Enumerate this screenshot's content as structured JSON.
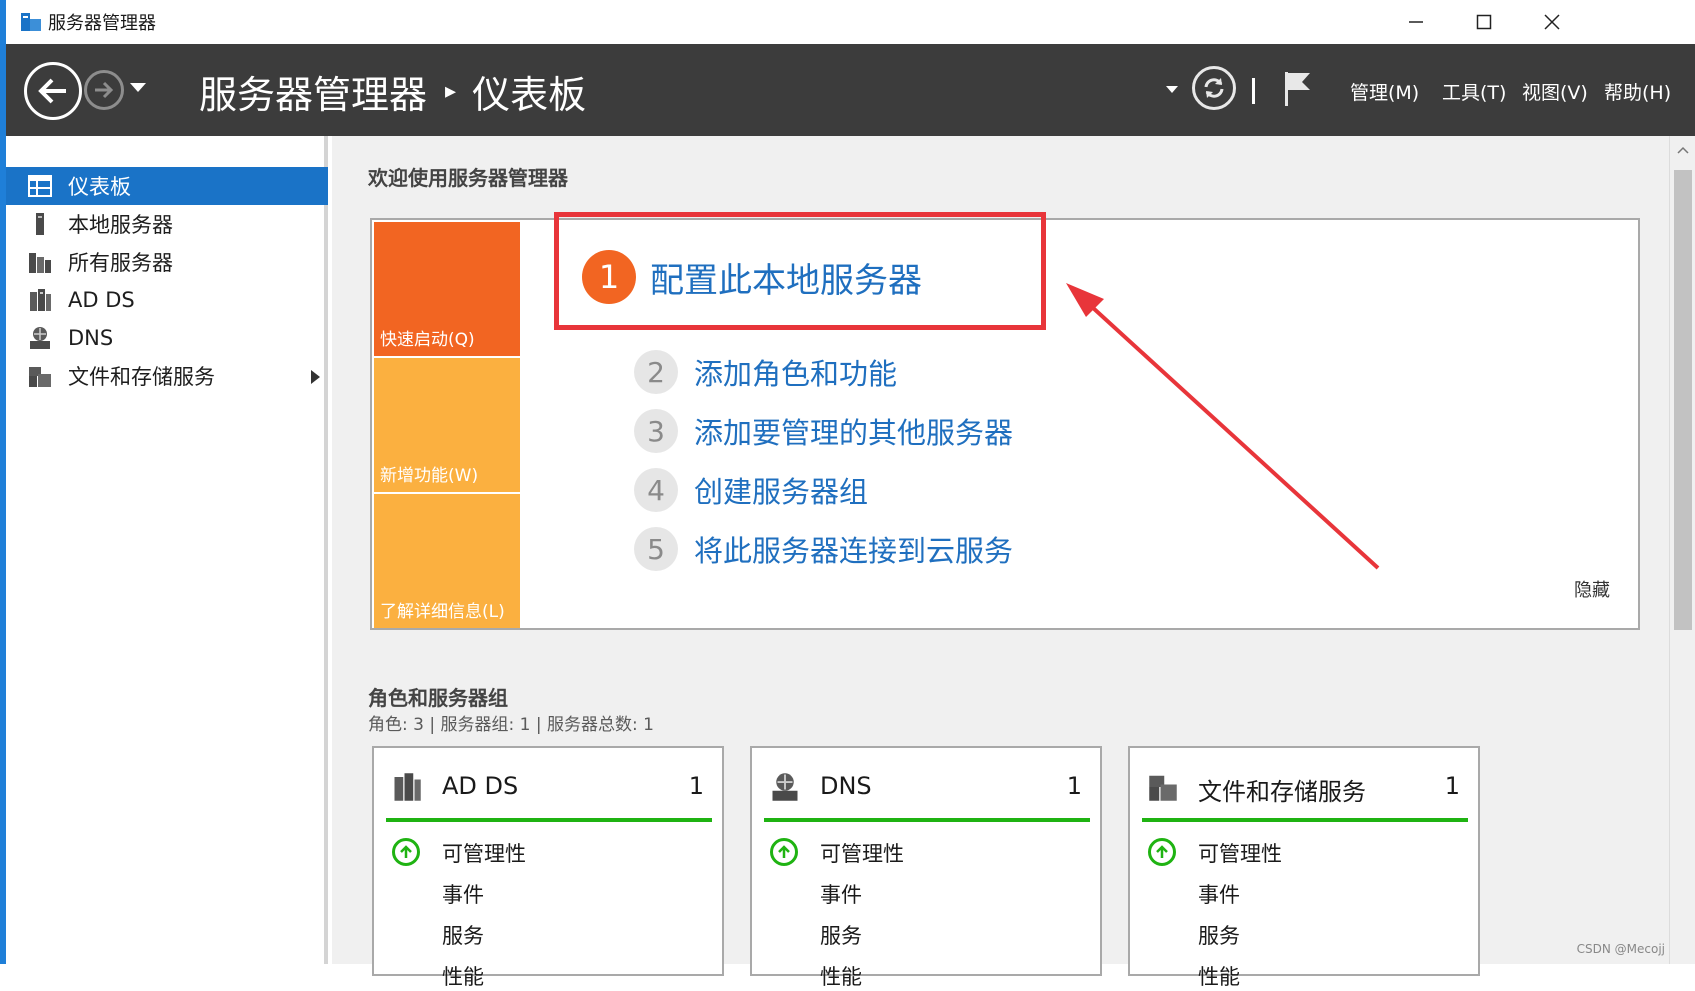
{
  "window": {
    "title": "服务器管理器"
  },
  "header": {
    "breadcrumb_root": "服务器管理器",
    "breadcrumb_sep": "▸",
    "breadcrumb_current": "仪表板",
    "menus": [
      "管理(M)",
      "工具(T)",
      "视图(V)",
      "帮助(H)"
    ]
  },
  "sidebar": {
    "items": [
      {
        "label": "仪表板",
        "icon": "dashboard-icon",
        "active": true
      },
      {
        "label": "本地服务器",
        "icon": "local-server-icon"
      },
      {
        "label": "所有服务器",
        "icon": "all-servers-icon"
      },
      {
        "label": "AD DS",
        "icon": "ad-ds-icon"
      },
      {
        "label": "DNS",
        "icon": "dns-icon"
      },
      {
        "label": "文件和存储服务",
        "icon": "file-storage-icon",
        "has_submenu": true
      }
    ]
  },
  "welcome": {
    "title": "欢迎使用服务器管理器",
    "tiles": [
      {
        "label": "快速启动(Q)",
        "color": "#f26522"
      },
      {
        "label": "新增功能(W)",
        "color": "#fbb040"
      },
      {
        "label": "了解详细信息(L)",
        "color": "#fbb040"
      }
    ],
    "steps": [
      {
        "num": "1",
        "label": "配置此本地服务器"
      },
      {
        "num": "2",
        "label": "添加角色和功能"
      },
      {
        "num": "3",
        "label": "添加要管理的其他服务器"
      },
      {
        "num": "4",
        "label": "创建服务器组"
      },
      {
        "num": "5",
        "label": "将此服务器连接到云服务"
      }
    ],
    "hide": "隐藏"
  },
  "roles": {
    "title": "角色和服务器组",
    "subtitle": "角色: 3 | 服务器组: 1 | 服务器总数: 1",
    "cards": [
      {
        "name": "AD DS",
        "count": "1",
        "icon": "ad-ds-icon",
        "rows": [
          "可管理性",
          "事件",
          "服务",
          "性能"
        ]
      },
      {
        "name": "DNS",
        "count": "1",
        "icon": "dns-icon",
        "rows": [
          "可管理性",
          "事件",
          "服务",
          "性能"
        ]
      },
      {
        "name": "文件和存储服务",
        "count": "1",
        "icon": "file-storage-icon",
        "rows": [
          "可管理性",
          "事件",
          "服务",
          "性能"
        ]
      }
    ]
  },
  "colors": {
    "accent_blue": "#1a73c7",
    "highlight_red": "#e8353a",
    "status_green": "#1fb312"
  },
  "watermark": "CSDN @Mecojj"
}
